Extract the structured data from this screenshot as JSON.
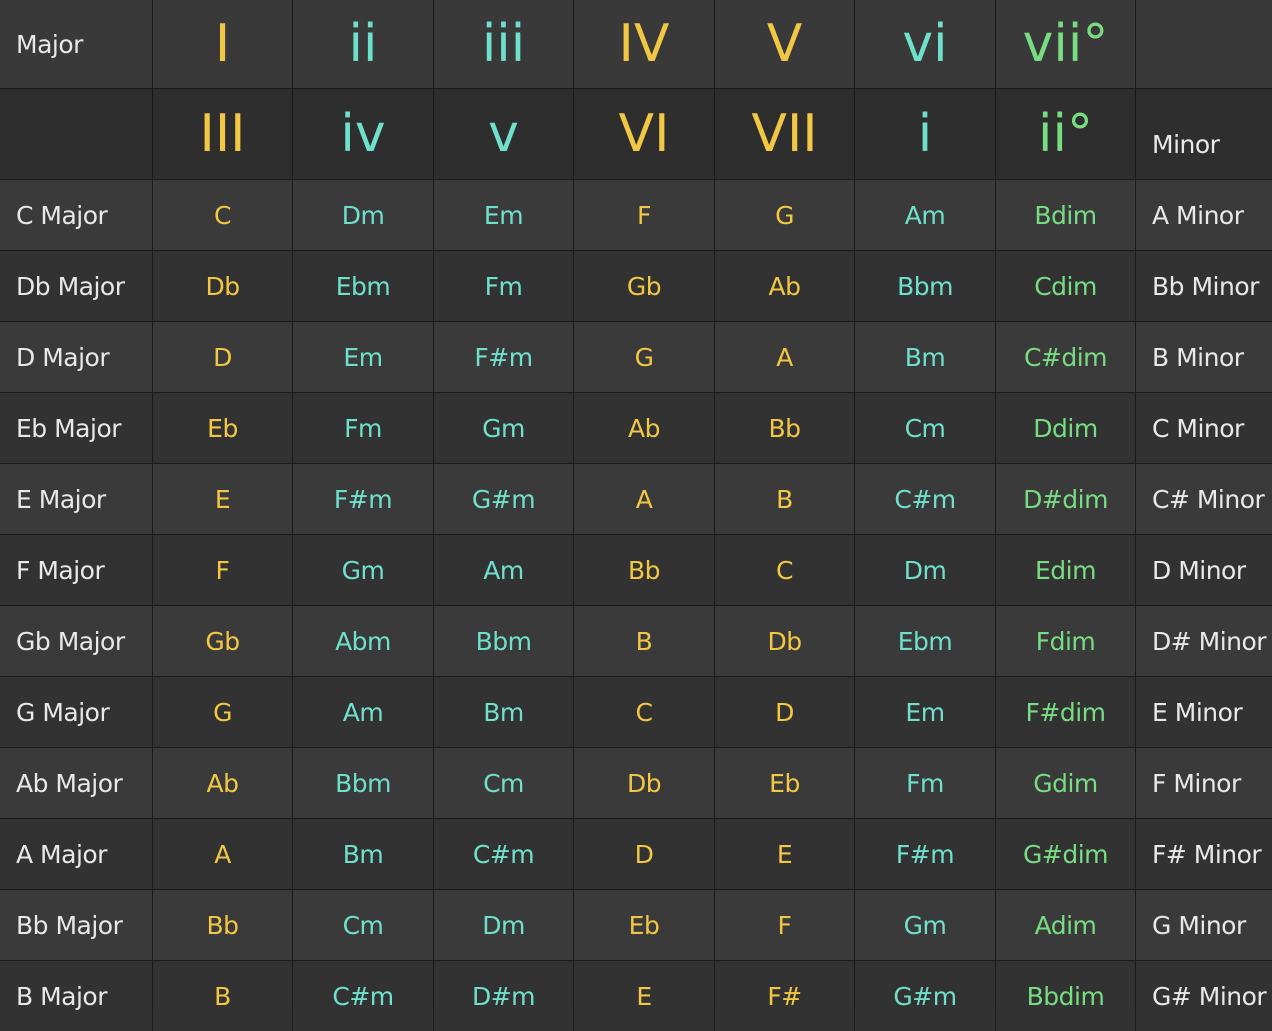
{
  "header": {
    "major_label": "Major",
    "minor_label": "Minor",
    "major_numerals": [
      {
        "text": "I",
        "quality": "major"
      },
      {
        "text": "ii",
        "quality": "minor"
      },
      {
        "text": "iii",
        "quality": "minor"
      },
      {
        "text": "IV",
        "quality": "major"
      },
      {
        "text": "V",
        "quality": "major"
      },
      {
        "text": "vi",
        "quality": "minor"
      },
      {
        "text": "vii°",
        "quality": "dim"
      }
    ],
    "minor_numerals": [
      {
        "text": "III",
        "quality": "major"
      },
      {
        "text": "iv",
        "quality": "minor"
      },
      {
        "text": "v",
        "quality": "minor"
      },
      {
        "text": "VI",
        "quality": "major"
      },
      {
        "text": "VII",
        "quality": "major"
      },
      {
        "text": "i",
        "quality": "minor"
      },
      {
        "text": "ii°",
        "quality": "dim"
      }
    ]
  },
  "column_qualities": [
    "major",
    "minor",
    "minor",
    "major",
    "major",
    "minor",
    "dim"
  ],
  "rows": [
    {
      "major_key": "C Major",
      "chords": [
        "C",
        "Dm",
        "Em",
        "F",
        "G",
        "Am",
        "Bdim"
      ],
      "minor_key": "A Minor"
    },
    {
      "major_key": "Db Major",
      "chords": [
        "Db",
        "Ebm",
        "Fm",
        "Gb",
        "Ab",
        "Bbm",
        "Cdim"
      ],
      "minor_key": "Bb Minor"
    },
    {
      "major_key": "D Major",
      "chords": [
        "D",
        "Em",
        "F#m",
        "G",
        "A",
        "Bm",
        "C#dim"
      ],
      "minor_key": "B Minor"
    },
    {
      "major_key": "Eb Major",
      "chords": [
        "Eb",
        "Fm",
        "Gm",
        "Ab",
        "Bb",
        "Cm",
        "Ddim"
      ],
      "minor_key": "C Minor"
    },
    {
      "major_key": "E Major",
      "chords": [
        "E",
        "F#m",
        "G#m",
        "A",
        "B",
        "C#m",
        "D#dim"
      ],
      "minor_key": "C# Minor"
    },
    {
      "major_key": "F Major",
      "chords": [
        "F",
        "Gm",
        "Am",
        "Bb",
        "C",
        "Dm",
        "Edim"
      ],
      "minor_key": "D Minor"
    },
    {
      "major_key": "Gb Major",
      "chords": [
        "Gb",
        "Abm",
        "Bbm",
        "B",
        "Db",
        "Ebm",
        "Fdim"
      ],
      "minor_key": "D# Minor"
    },
    {
      "major_key": "G Major",
      "chords": [
        "G",
        "Am",
        "Bm",
        "C",
        "D",
        "Em",
        "F#dim"
      ],
      "minor_key": "E Minor"
    },
    {
      "major_key": "Ab Major",
      "chords": [
        "Ab",
        "Bbm",
        "Cm",
        "Db",
        "Eb",
        "Fm",
        "Gdim"
      ],
      "minor_key": "F Minor"
    },
    {
      "major_key": "A Major",
      "chords": [
        "A",
        "Bm",
        "C#m",
        "D",
        "E",
        "F#m",
        "G#dim"
      ],
      "minor_key": "F# Minor"
    },
    {
      "major_key": "Bb Major",
      "chords": [
        "Bb",
        "Cm",
        "Dm",
        "Eb",
        "F",
        "Gm",
        "Adim"
      ],
      "minor_key": "G Minor"
    },
    {
      "major_key": "B Major",
      "chords": [
        "B",
        "C#m",
        "D#m",
        "E",
        "F#",
        "G#m",
        "Bbdim"
      ],
      "minor_key": "G# Minor"
    }
  ],
  "colors": {
    "major": "#f2c744",
    "minor": "#6fe0cb",
    "dim": "#78dc82",
    "label": "#e8e8e8"
  }
}
